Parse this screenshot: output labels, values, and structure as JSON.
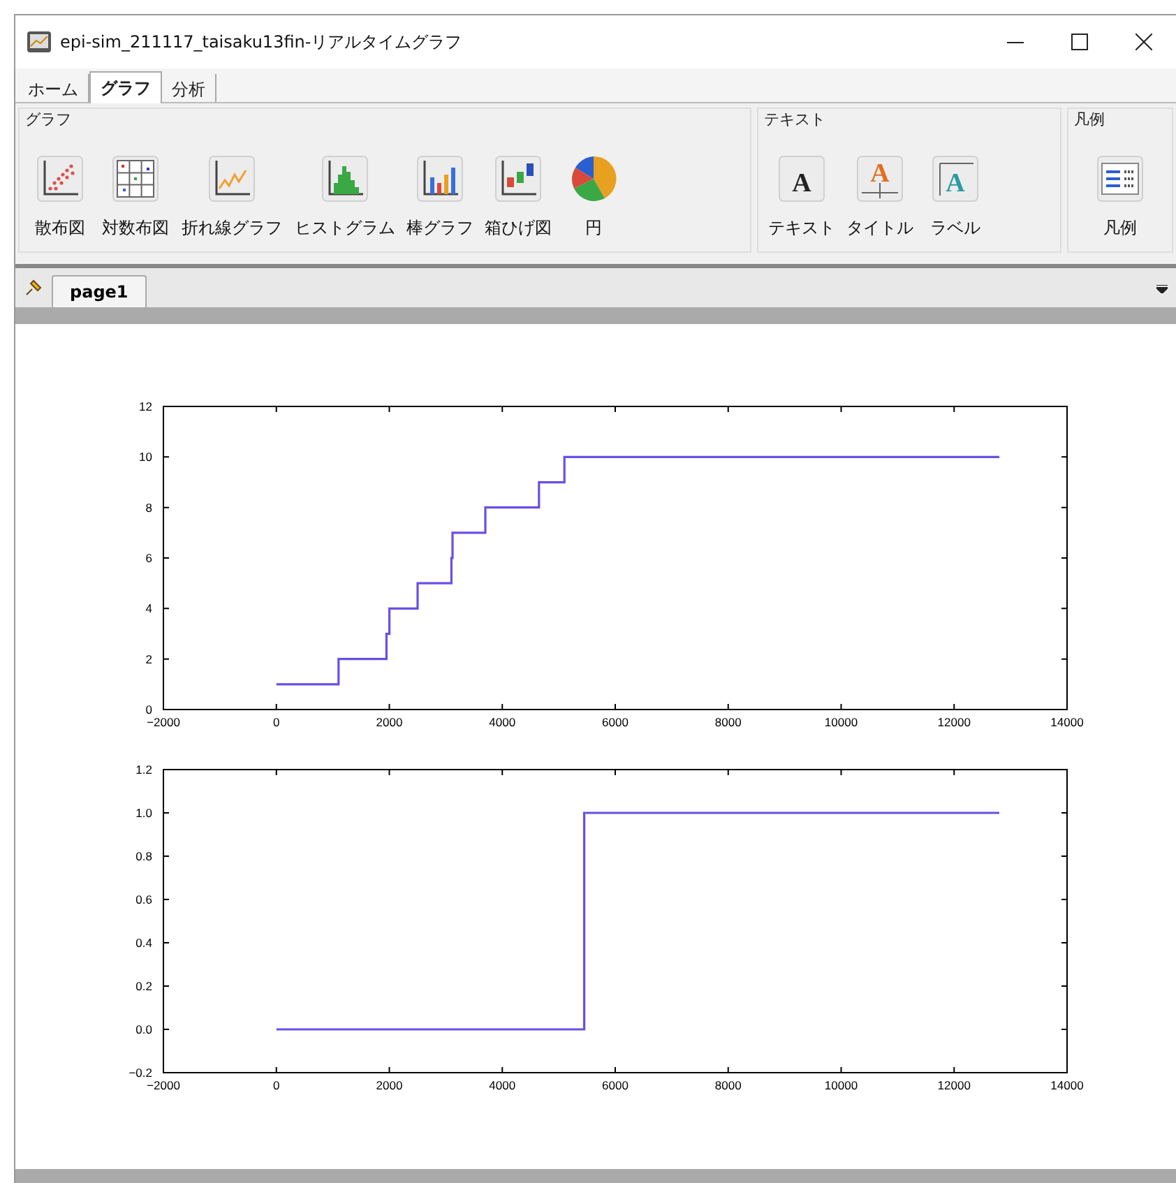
{
  "window": {
    "title": "epi-sim_211117_taisaku13fin-リアルタイムグラフ"
  },
  "tabs": [
    {
      "label": "ホーム",
      "selected": false
    },
    {
      "label": "グラフ",
      "selected": true
    },
    {
      "label": "分析",
      "selected": false
    }
  ],
  "ribbon": {
    "groups": [
      {
        "title": "グラフ",
        "buttons": [
          "散布図",
          "対数布図",
          "折れ線グラフ",
          "ヒストグラム",
          "棒グラフ",
          "箱ひげ図",
          "円"
        ]
      },
      {
        "title": "テキスト",
        "buttons": [
          "テキスト",
          "タイトル",
          "ラベル"
        ],
        "icon_letters": [
          "A",
          "A",
          "A"
        ]
      },
      {
        "title": "凡例",
        "buttons": [
          "凡例"
        ]
      }
    ]
  },
  "page_tabs": [
    {
      "label": "page1",
      "selected": true
    }
  ],
  "charts": [
    {
      "chart_data": {
        "type": "line",
        "x": [
          0,
          1100,
          1100,
          1950,
          1950,
          2000,
          2000,
          2500,
          2500,
          3100,
          3100,
          3120,
          3120,
          3700,
          3700,
          4650,
          4650,
          5100,
          5100,
          12800
        ],
        "series": [
          {
            "color": "#6a4fe6",
            "values": [
              1,
              1,
              2,
              2,
              3,
              3,
              4,
              4,
              5,
              5,
              6,
              6,
              7,
              7,
              8,
              8,
              9,
              9,
              10,
              10
            ]
          }
        ],
        "xlim": [
          -2000,
          14000
        ],
        "ylim": [
          0,
          12
        ],
        "xticks": [
          {
            "value": -2000,
            "label": "−2000"
          },
          0,
          2000,
          4000,
          6000,
          8000,
          10000,
          12000,
          14000
        ],
        "yticks": [
          0,
          2,
          4,
          6,
          8,
          10,
          12
        ]
      }
    },
    {
      "chart_data": {
        "type": "line",
        "x": [
          0,
          5450,
          5450,
          12800
        ],
        "series": [
          {
            "color": "#6a4fe6",
            "values": [
              0,
              0,
              1,
              1
            ]
          }
        ],
        "xlim": [
          -2000,
          14000
        ],
        "ylim": [
          -0.2,
          1.2
        ],
        "xticks": [
          {
            "value": -2000,
            "label": "−2000"
          },
          0,
          2000,
          4000,
          6000,
          8000,
          10000,
          12000,
          14000
        ],
        "yticks": [
          {
            "value": -0.2,
            "label": "−0.2"
          },
          {
            "value": 0,
            "label": "0.0"
          },
          {
            "value": 0.2,
            "label": "0.2"
          },
          {
            "value": 0.4,
            "label": "0.4"
          },
          {
            "value": 0.6,
            "label": "0.6"
          },
          {
            "value": 0.8,
            "label": "0.8"
          },
          {
            "value": 1,
            "label": "1.0"
          },
          {
            "value": 1.2,
            "label": "1.2"
          }
        ]
      }
    }
  ]
}
